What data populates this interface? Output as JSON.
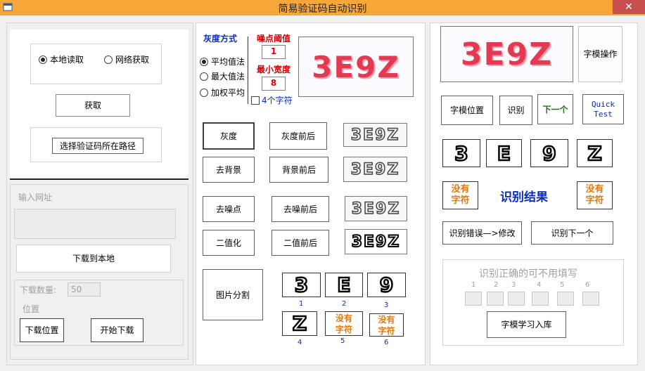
{
  "window": {
    "title": "简易验证码自动识别",
    "close": "✕"
  },
  "left": {
    "radio_local": "本地读取",
    "radio_net": "网络获取",
    "fetch_btn": "获取",
    "path_btn": "选择验证码所在路径",
    "url_label": "输入网址",
    "download_local_btn": "下载到本地",
    "download_count_label": "下载数量:",
    "download_count_value": "50",
    "location_label": "位置",
    "download_location_btn": "下载位置",
    "start_download_btn": "开始下载"
  },
  "middle": {
    "gray_mode_title": "灰度方式",
    "noise_threshold_label": "噪点阈值",
    "noise_threshold_value": "1",
    "min_width_label": "最小宽度",
    "min_width_value": "8",
    "radio_avg": "平均值法",
    "radio_max": "最大值法",
    "radio_weighted": "加权平均",
    "four_chars": "4个字符",
    "captcha_text": "3E9Z",
    "gray_btn": "灰度",
    "gray_compare_btn": "灰度前后",
    "bg_btn": "去背景",
    "bg_compare_btn": "背景前后",
    "denoise_btn": "去噪点",
    "denoise_compare_btn": "去噪前后",
    "binarize_btn": "二值化",
    "binarize_compare_btn": "二值前后",
    "split_btn": "图片分割",
    "split_chars": [
      "3",
      "E",
      "9",
      "Z"
    ],
    "no_char": "没有\n字符",
    "slot_labels": [
      "1",
      "2",
      "3",
      "4",
      "5",
      "6"
    ]
  },
  "right": {
    "captcha_text": "3E9Z",
    "font_ops_btn": "字模操作",
    "font_pos_btn": "字模位置",
    "recognize_btn": "识别",
    "next_btn": "下一个",
    "quick_test_btn": "Quick\nTest",
    "chars": [
      "3",
      "E",
      "9",
      "Z"
    ],
    "no_char": "没有\n字符",
    "result_title": "识别结果",
    "fix_btn": "识别错误—>修改",
    "recognize_next_btn": "识别下一个",
    "correct_hint": "识别正确的可不用填写",
    "slot_labels": [
      "1",
      "2",
      "3",
      "4",
      "5",
      "6"
    ],
    "learn_btn": "字模学习入库"
  },
  "colors": {
    "titlebar": "#f7a638",
    "close": "#c74f50",
    "blue_title": "#0a2db8",
    "red_label": "#d40000",
    "orange": "#e07a10",
    "green": "#0c7a0c"
  }
}
